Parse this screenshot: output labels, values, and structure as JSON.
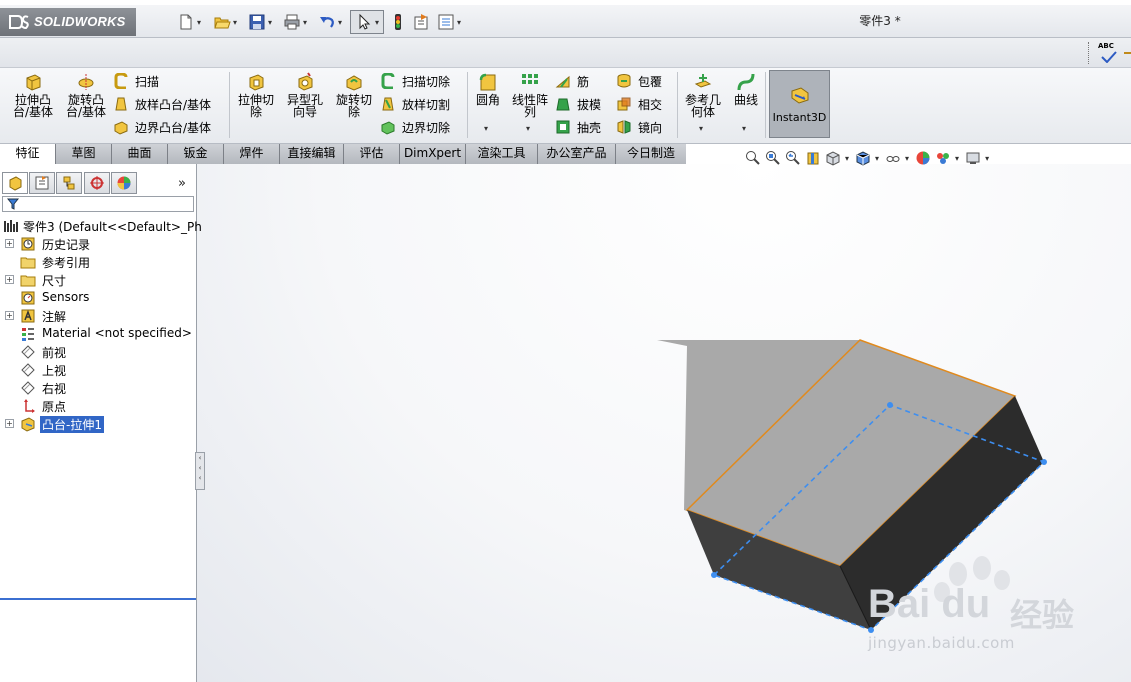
{
  "app": {
    "logo_text": "SOLIDWORKS",
    "document_title": "零件3 *"
  },
  "ribbon": {
    "extrude_boss": "拉伸凸台/基体",
    "revolve_boss": "旋转凸台/基体",
    "sweep": "扫描",
    "loft": "放样凸台/基体",
    "boundary_boss": "边界凸台/基体",
    "extrude_cut": "拉伸切除",
    "hole_wizard": "异型孔向导",
    "revolve_cut": "旋转切除",
    "swept_cut": "扫描切除",
    "lofted_cut": "放样切割",
    "boundary_cut": "边界切除",
    "fillet": "圆角",
    "linear_pattern": "线性阵列",
    "rib": "筋",
    "draft": "拔模",
    "shell": "抽壳",
    "wrap": "包覆",
    "intersect": "相交",
    "mirror": "镜向",
    "ref_geometry": "参考几何体",
    "curves": "曲线",
    "instant3d": "Instant3D"
  },
  "tabs": [
    {
      "label": "特征"
    },
    {
      "label": "草图"
    },
    {
      "label": "曲面"
    },
    {
      "label": "钣金"
    },
    {
      "label": "焊件"
    },
    {
      "label": "直接编辑"
    },
    {
      "label": "评估"
    },
    {
      "label": "DimXpert"
    },
    {
      "label": "渲染工具"
    },
    {
      "label": "办公室产品"
    },
    {
      "label": "今日制造"
    }
  ],
  "panel": {
    "expand_glyph": "»",
    "tree": [
      {
        "label": "零件3  (Default<<Default>_Ph"
      },
      {
        "label": "历史记录"
      },
      {
        "label": "参考引用"
      },
      {
        "label": "尺寸"
      },
      {
        "label": "Sensors"
      },
      {
        "label": "注解"
      },
      {
        "label": "Material <not specified>"
      },
      {
        "label": "前视"
      },
      {
        "label": "上视"
      },
      {
        "label": "右视"
      },
      {
        "label": "原点"
      },
      {
        "label": "凸台-拉伸1"
      }
    ]
  },
  "spellcheck_label": "ABC",
  "watermark": {
    "brand": "Bai du",
    "brand_cn": "经验",
    "url": "jingyan.baidu.com"
  },
  "colors": {
    "selection": "#3166c6",
    "edge_highlight": "#e08a1e",
    "dashed_sketch": "#3d8ef0",
    "face_top": "#a9a9a9",
    "face_front": "#3f3f3f",
    "face_side": "#2c2c2c"
  }
}
